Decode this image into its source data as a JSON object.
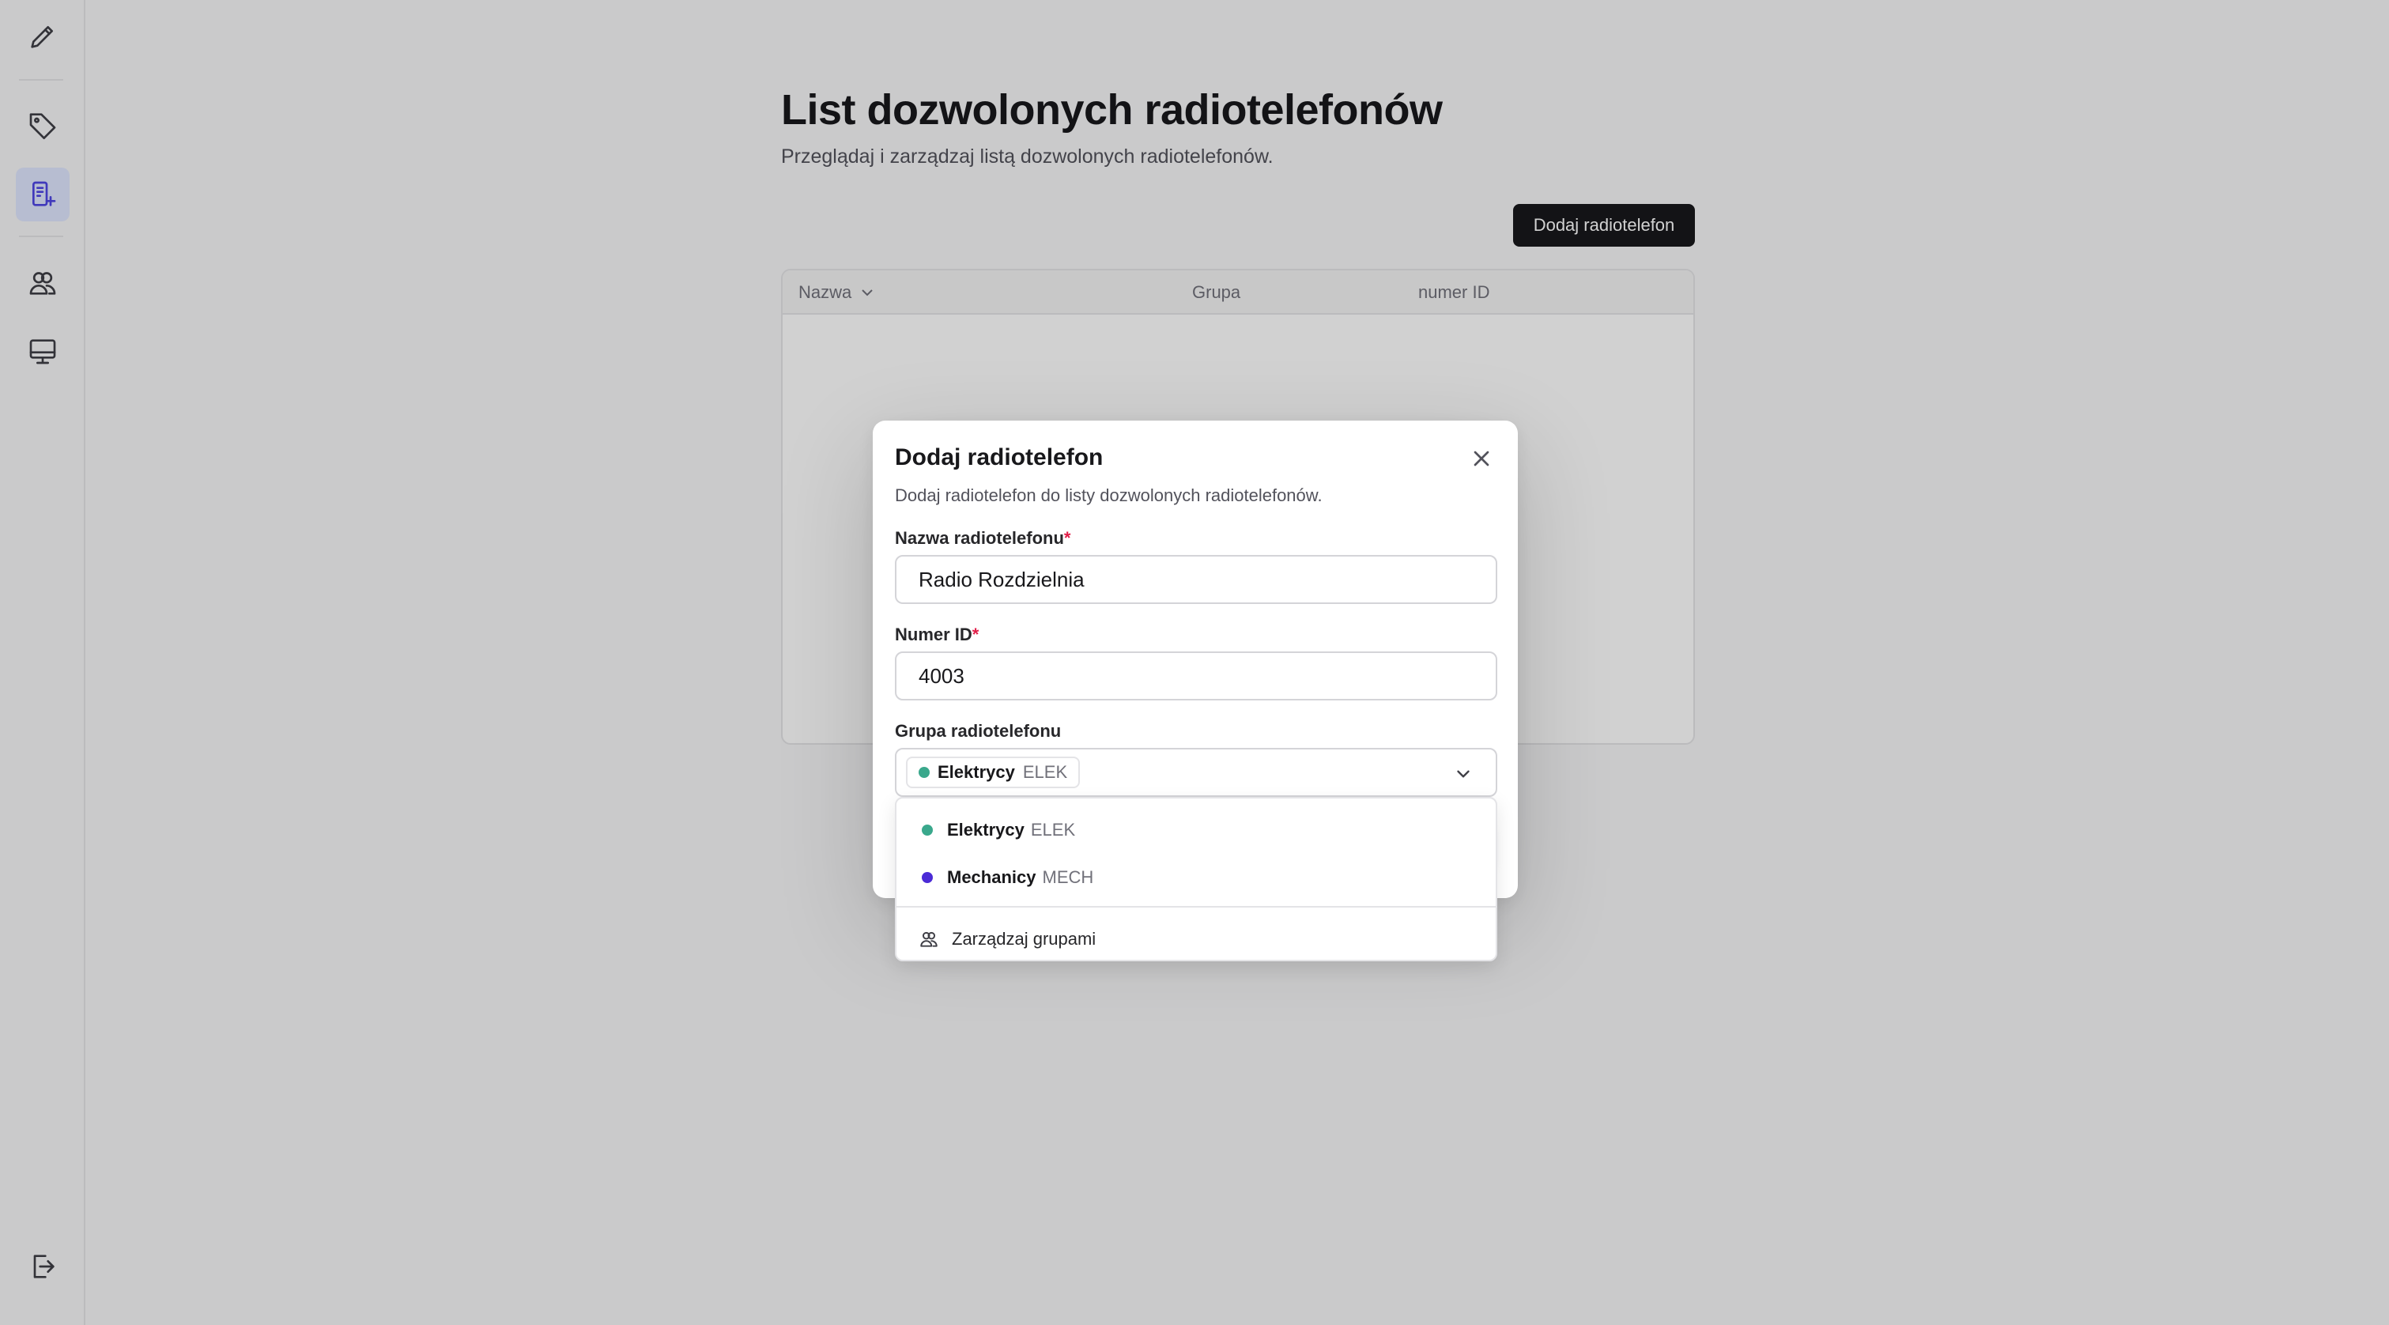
{
  "page": {
    "title": "List dozwolonych radiotelefonów",
    "subtitle": "Przeglądaj i zarządzaj listą dozwolonych radiotelefonów.",
    "add_button": "Dodaj radiotelefon"
  },
  "table": {
    "columns": [
      "Nazwa",
      "Grupa",
      "numer ID"
    ]
  },
  "sidebar": {
    "items": [
      {
        "icon": "pencil-icon",
        "active": false
      },
      {
        "icon": "tag-icon",
        "active": false
      },
      {
        "icon": "device-add-icon",
        "active": true
      },
      {
        "icon": "users-icon",
        "active": false
      },
      {
        "icon": "monitor-icon",
        "active": false
      }
    ],
    "bottom": {
      "icon": "logout-icon"
    }
  },
  "modal": {
    "title": "Dodaj radiotelefon",
    "description": "Dodaj radiotelefon do listy dozwolonych radiotelefonów.",
    "name_label": "Nazwa radiotelefonu",
    "name_value": "Radio Rozdzielnia",
    "id_label": "Numer ID",
    "id_value": "4003",
    "group_label": "Grupa radiotelefonu",
    "required_mark": "*",
    "selected_group": {
      "name": "Elektrycy",
      "code": "ELEK",
      "color": "#3aa88c"
    }
  },
  "dropdown": {
    "options": [
      {
        "name": "Elektrycy",
        "code": "ELEK",
        "color": "#3aa88c"
      },
      {
        "name": "Mechanicy",
        "code": "MECH",
        "color": "#4b2bd6"
      }
    ],
    "manage_label": "Zarządzaj grupami"
  }
}
